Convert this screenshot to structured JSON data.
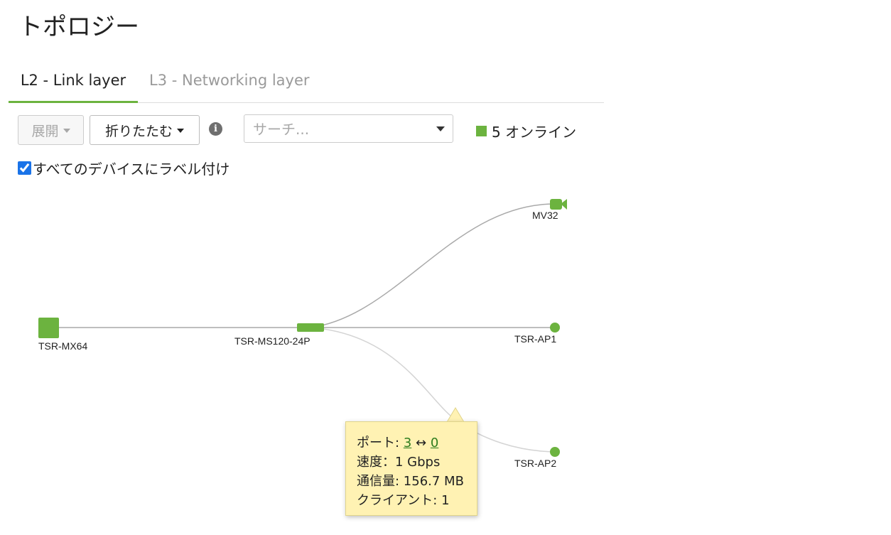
{
  "page": {
    "title": "トポロジー"
  },
  "tabs": [
    {
      "label": "L2 - Link layer",
      "active": true
    },
    {
      "label": "L3 - Networking layer",
      "active": false
    }
  ],
  "toolbar": {
    "expand_label": "展開",
    "collapse_label": "折りたたむ",
    "info_glyph": "i",
    "search_placeholder": "サーチ...",
    "online_count_label": "5 オンライン",
    "online_color": "#6cb33f"
  },
  "options": {
    "label_all_devices": "すべてのデバイスにラベル付け",
    "label_all_checked": true
  },
  "devices": [
    {
      "name": "TSR-MX64",
      "type": "appliance"
    },
    {
      "name": "TSR-MS120-24P",
      "type": "switch"
    },
    {
      "name": "MV32",
      "type": "camera"
    },
    {
      "name": "TSR-AP1",
      "type": "access-point"
    },
    {
      "name": "TSR-AP2",
      "type": "access-point"
    }
  ],
  "tooltip": {
    "port_label": "ポート:",
    "port_a": "3",
    "port_arrow": "↔",
    "port_b": "0",
    "speed_line": "速度：1 Gbps",
    "traffic_line": "通信量: 156.7 MB",
    "clients_line": "クライアント: 1"
  },
  "colors": {
    "accent": "#6cb33f",
    "tooltip_bg": "#fff2b3",
    "link_dark": "#a9a9a9",
    "link_light": "#d4d4d4"
  }
}
